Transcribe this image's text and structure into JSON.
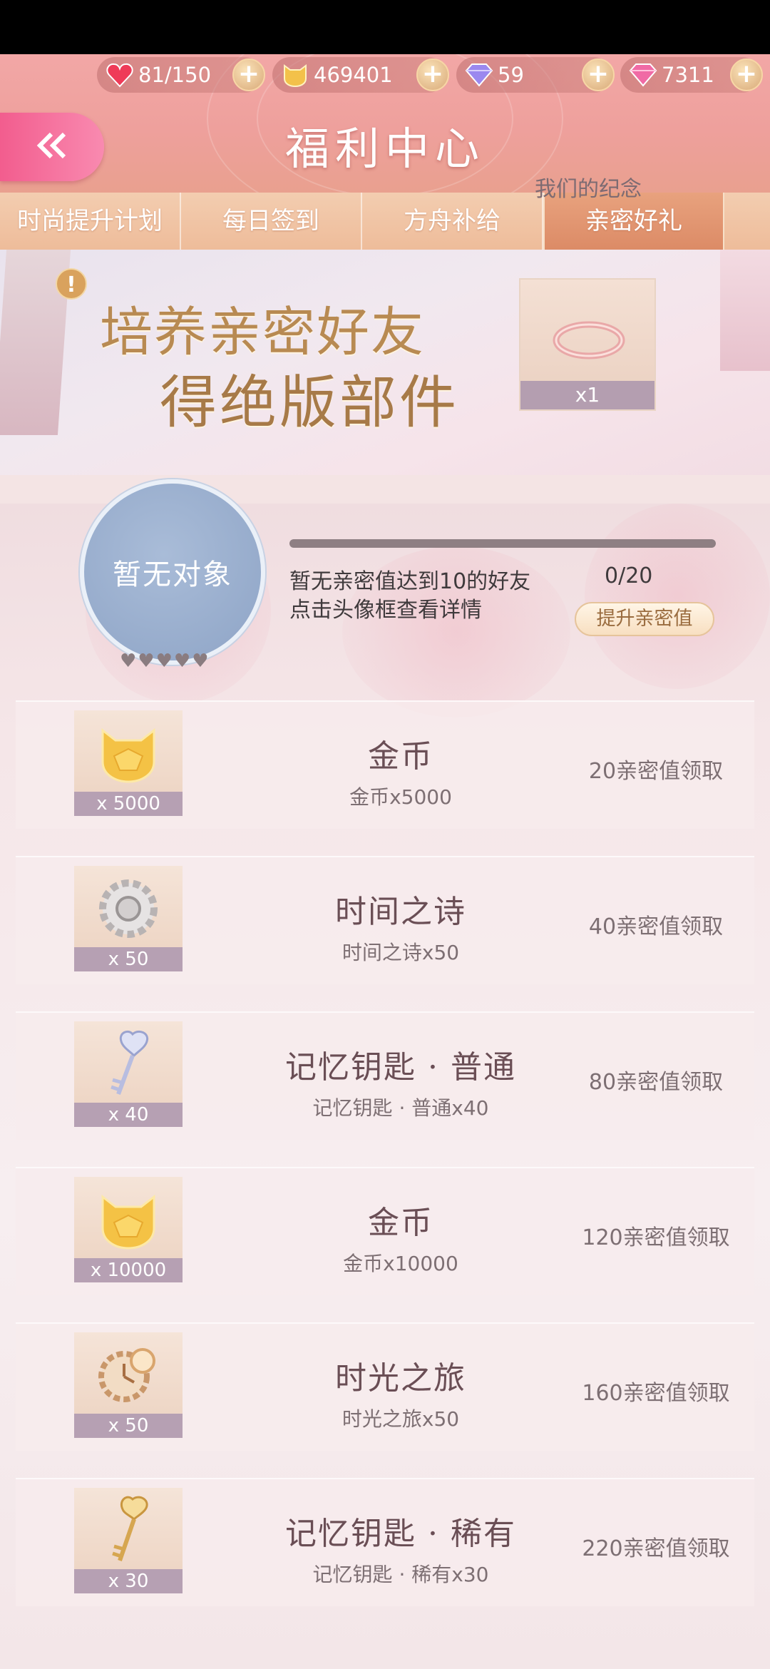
{
  "resources": [
    {
      "icon": "heart-icon",
      "value": "81/150"
    },
    {
      "icon": "cat-coin-icon",
      "value": "469401"
    },
    {
      "icon": "diamond-icon",
      "value": "59"
    },
    {
      "icon": "pink-gem-icon",
      "value": "7311"
    }
  ],
  "header": {
    "title": "福利中心"
  },
  "tabs": [
    {
      "label": "时尚提升计划"
    },
    {
      "label": "每日签到"
    },
    {
      "label": "方舟补给"
    },
    {
      "label": "亲密好礼"
    }
  ],
  "banner": {
    "line1": "培养亲密好友",
    "line2": "得绝版部件",
    "reward_qty": "x1",
    "reward_name": "我们的纪念"
  },
  "friend": {
    "frame_text": "暂无对象",
    "hearts": "♥♥♥♥♥",
    "status": "暂无亲密值达到10的好友",
    "progress": "0/20",
    "progress_fraction": 0,
    "hint": "点击头像框查看详情",
    "boost_label": "提升亲密值"
  },
  "rewards": [
    {
      "icon": "gold-coin-icon",
      "qty": "x 5000",
      "name": "金币",
      "desc": "金币x5000",
      "claim": "20亲密值领取"
    },
    {
      "icon": "gear-icon",
      "qty": "x 50",
      "name": "时间之诗",
      "desc": "时间之诗x50",
      "claim": "40亲密值领取"
    },
    {
      "icon": "key-icon",
      "qty": "x 40",
      "name": "记忆钥匙 · 普通",
      "desc": "记忆钥匙 · 普通x40",
      "claim": "80亲密值领取"
    },
    {
      "icon": "gold-coin-icon",
      "qty": "x 10000",
      "name": "金币",
      "desc": "金币x10000",
      "claim": "120亲密值领取"
    },
    {
      "icon": "clock-gear-icon",
      "qty": "x 50",
      "name": "时光之旅",
      "desc": "时光之旅x50",
      "claim": "160亲密值领取"
    },
    {
      "icon": "golden-key-icon",
      "qty": "x 30",
      "name": "记忆钥匙 · 稀有",
      "desc": "记忆钥匙 · 稀有x30",
      "claim": "220亲密值领取"
    }
  ],
  "colors": {
    "header": "#eea09c",
    "tab_active": "#dc8b66",
    "back_button": "#f25d8e",
    "progress_fill": "#f18bb0"
  }
}
